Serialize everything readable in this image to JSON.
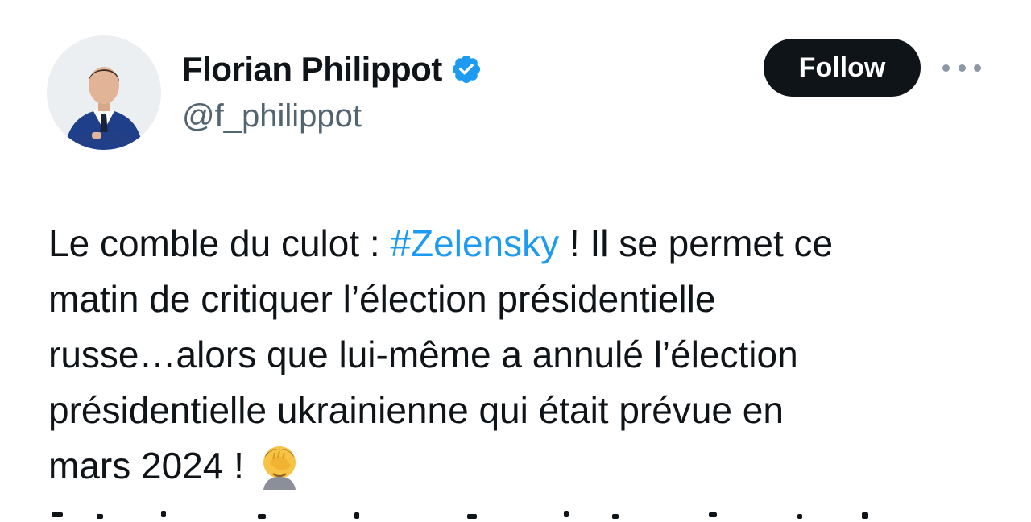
{
  "author": {
    "display_name": "Florian Philippot",
    "handle": "@f_philippot",
    "verified": true,
    "avatar_icon": "profile-photo"
  },
  "actions": {
    "follow_label": "Follow",
    "more_icon": "more-horizontal-icon"
  },
  "tweet": {
    "line1_before": "Le comble du culot : ",
    "hashtag": "#Zelensky",
    "line1_after": " ! Il se permet ce",
    "line2": "matin de critiquer l’élection présidentielle",
    "line3": "russe…alors que lui-même a annulé l’élection",
    "line4": "présidentielle ukrainienne qui était prévue en",
    "line5": "mars 2024 !",
    "emoji_icon": "face-palm-emoji"
  },
  "colors": {
    "text": "#0f1419",
    "secondary": "#536471",
    "link": "#1d9bf0",
    "verified": "#1d9bf0",
    "follow_bg": "#0f1419",
    "follow_text": "#ffffff"
  }
}
